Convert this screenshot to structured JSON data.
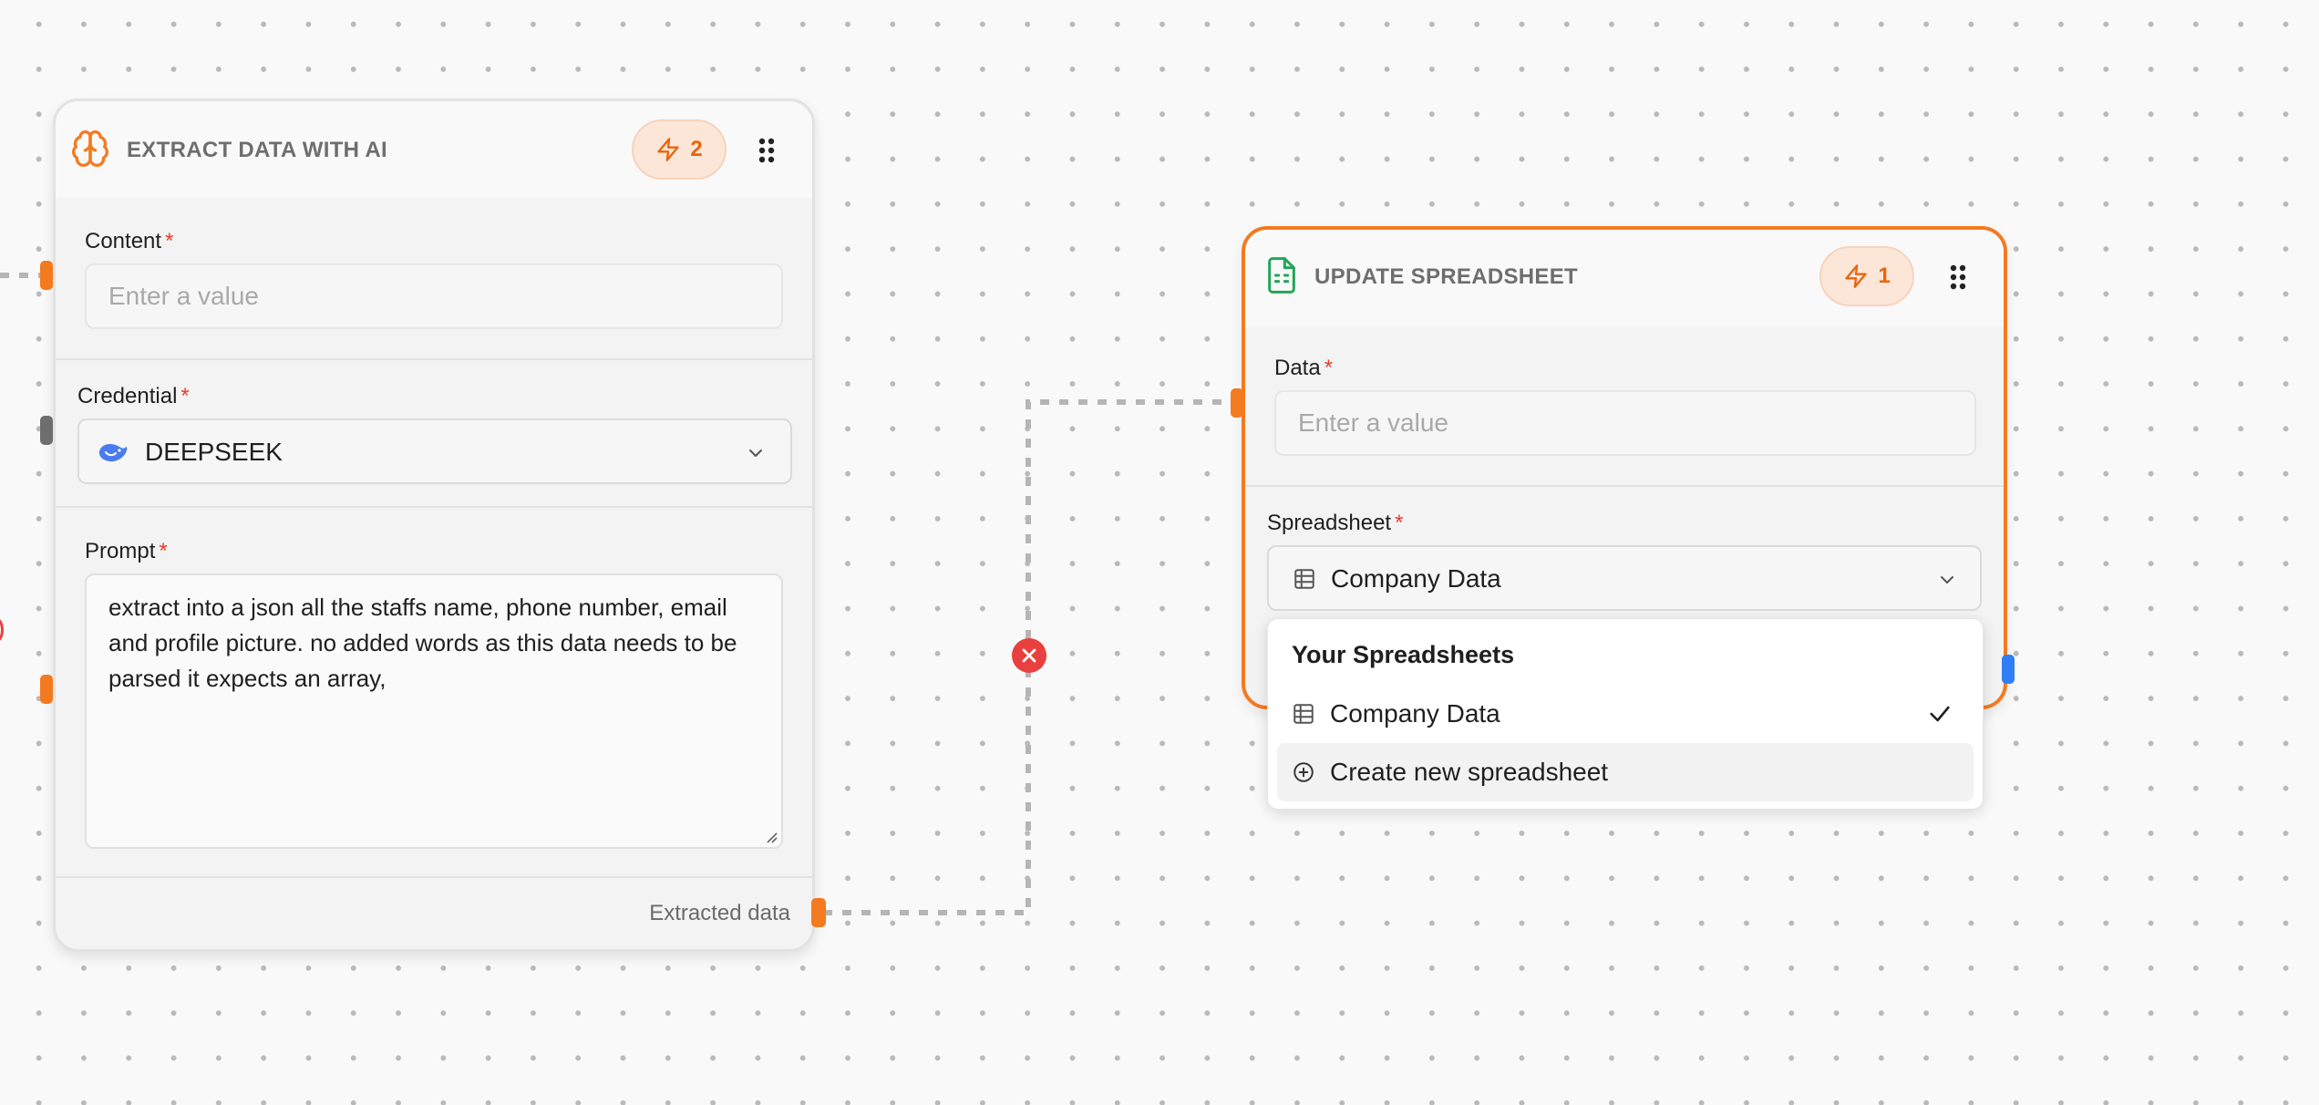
{
  "colors": {
    "accent": "#f47a20",
    "required": "#e43d30",
    "error": "#e8403e",
    "sheets_green": "#22a55a"
  },
  "extract_node": {
    "title": "EXTRACT DATA WITH AI",
    "icon": "brain-icon",
    "badge_count": "2",
    "fields": {
      "content": {
        "label": "Content",
        "required_mark": "*",
        "placeholder": "Enter a value"
      },
      "credential": {
        "label": "Credential",
        "required_mark": "*",
        "value": "DEEPSEEK",
        "icon": "deepseek-whale-icon"
      },
      "prompt": {
        "label": "Prompt",
        "required_mark": "*",
        "value": "extract into a json all the staffs  name, phone number, email and profile picture. no added words as this data needs to be parsed it expects an array,"
      }
    },
    "output_label": "Extracted data"
  },
  "update_node": {
    "title": "UPDATE SPREADSHEET",
    "icon": "spreadsheet-icon",
    "badge_count": "1",
    "fields": {
      "data": {
        "label": "Data",
        "required_mark": "*",
        "placeholder": "Enter a value"
      },
      "spreadsheet": {
        "label": "Spreadsheet",
        "required_mark": "*",
        "value": "Company Data",
        "icon": "table-icon"
      }
    }
  },
  "spreadsheet_dropdown": {
    "heading": "Your Spreadsheets",
    "options": [
      {
        "label": "Company Data",
        "icon": "table-icon",
        "selected": true
      },
      {
        "label": "Create new spreadsheet",
        "icon": "plus-circle-icon",
        "selected": false
      }
    ]
  }
}
